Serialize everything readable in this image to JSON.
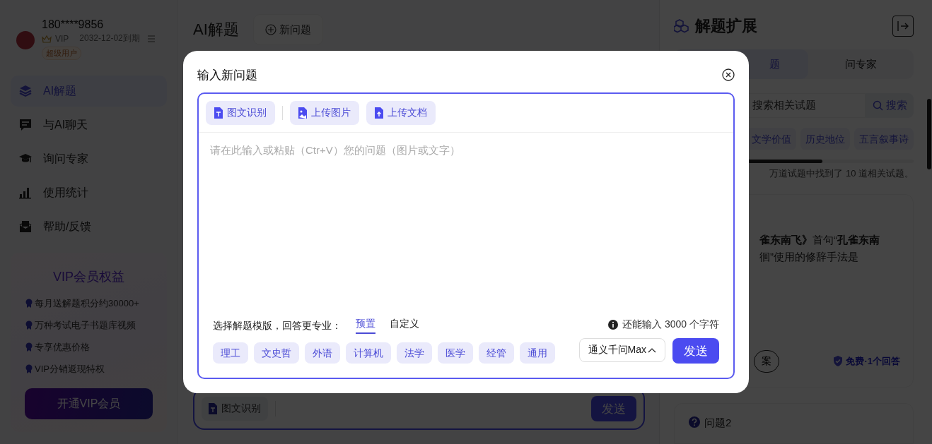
{
  "sidebar": {
    "user": {
      "phone": "180****9856",
      "vip": "VIP",
      "expiry": "2032-12-02到期",
      "badge": "超级用户"
    },
    "nav": [
      {
        "label": "AI解题",
        "kind": "layers",
        "selected": true
      },
      {
        "label": "与AI聊天",
        "kind": "chat",
        "selected": false
      },
      {
        "label": "询问专家",
        "kind": "cap",
        "selected": false
      },
      {
        "label": "使用统计",
        "kind": "chart",
        "selected": false
      },
      {
        "label": "帮助/反馈",
        "kind": "mail",
        "selected": false
      }
    ],
    "vip_card": {
      "title": "VIP会员权益",
      "benefits": [
        "每月送解题积分约30000+",
        "万种考试电子书题库视频",
        "专享优惠价格",
        "VIP分销返现特权"
      ],
      "button": "开通VIP会员"
    }
  },
  "main": {
    "title": "AI解题",
    "new_button": "新问题",
    "composer": {
      "tool": "图文识别",
      "send": "发送"
    }
  },
  "right_panel": {
    "title": "解题扩展",
    "tabs": [
      {
        "label": "题",
        "selected": true
      },
      {
        "label": "问专家",
        "selected": false
      }
    ],
    "search": {
      "placeholder": "搜索相关试题",
      "button": "搜索"
    },
    "tags": [
      "文学价值",
      "历史地位",
      "五言叙事诗"
    ],
    "result_text": "万道试题中找到了 10 道相关试题。",
    "card": {
      "question": "**雀东南飞》**首句“**孔雀东南**",
      "question_line2": "徊”使用的修辞手法是",
      "answer_button": "案",
      "meta": "免费·1个回答"
    },
    "next_card": {
      "title": "问题2"
    }
  },
  "modal": {
    "title": "输入新问题",
    "tools": [
      {
        "label": "图文识别",
        "kind": "ocr"
      },
      {
        "label": "上传图片",
        "kind": "image"
      },
      {
        "label": "上传文档",
        "kind": "doc"
      }
    ],
    "placeholder": "请在此输入或粘贴（Ctr+V）您的问题（图片或文字）",
    "template_label": "选择解题模版，回答更专业：",
    "template_tabs": [
      {
        "label": "预置",
        "selected": true
      },
      {
        "label": "自定义",
        "selected": false
      }
    ],
    "subjects": [
      "理工",
      "文史哲",
      "外语",
      "计算机",
      "法学",
      "医学",
      "经管",
      "通用"
    ],
    "char_hint": "还能输入 3000 个字符",
    "model": "通义千问Max",
    "send": "发送"
  }
}
